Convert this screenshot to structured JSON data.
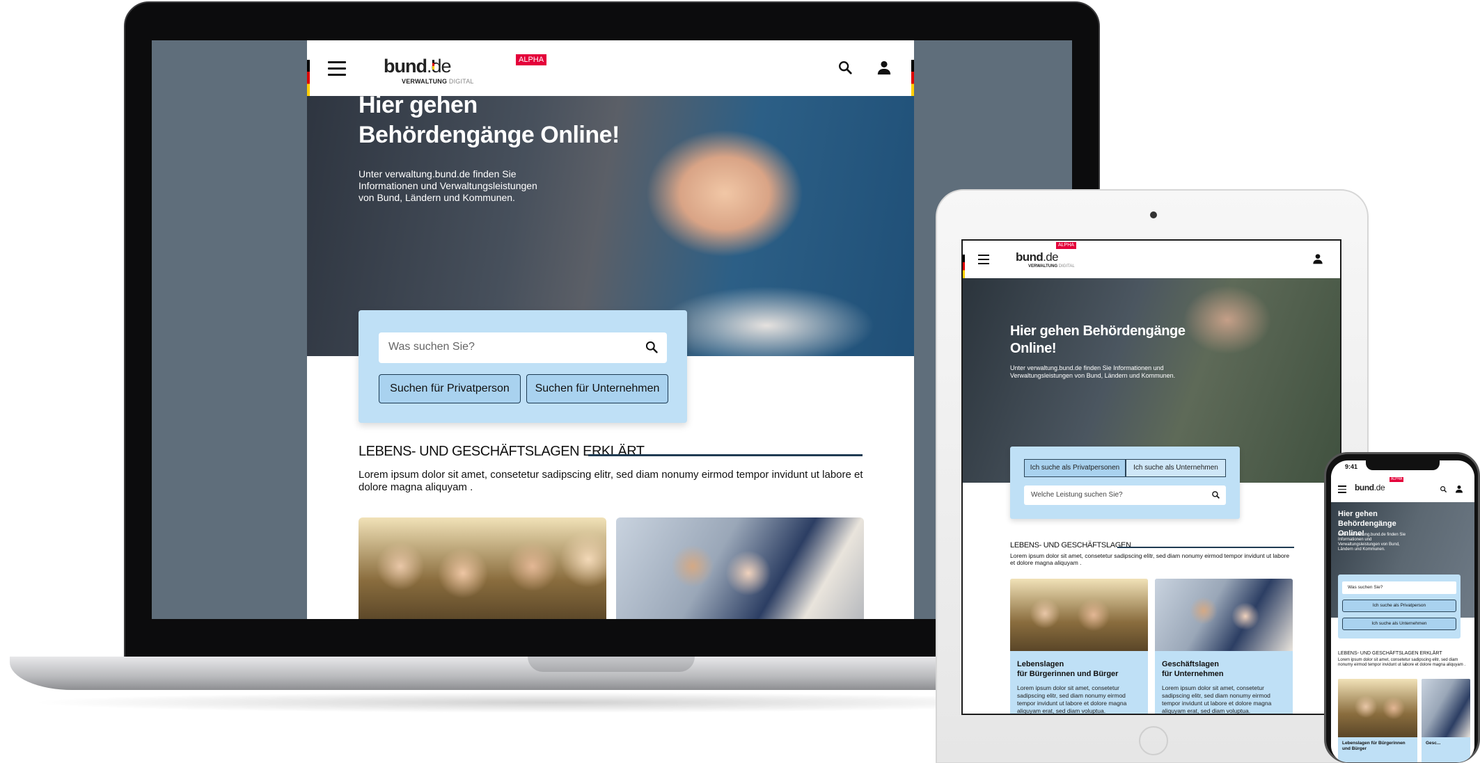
{
  "brand": {
    "word": "bund",
    "tld": ".de",
    "sub_main": "VERWALTUNG",
    "sub_light": "DIGITAL",
    "badge": "ALPHA"
  },
  "desktop": {
    "hero_title": "Hier gehen Behördengänge Online!",
    "hero_text": "Unter verwaltung.bund.de finden Sie Informationen und Verwaltungsleistungen von Bund, Ländern und Kommunen.",
    "search_placeholder": "Was suchen Sie?",
    "btn_private": "Suchen für Privatperson",
    "btn_business": "Suchen für Unternehmen",
    "section_title": "LEBENS- UND GESCHÄFTSLAGEN ERKLÄRT",
    "section_text": "Lorem ipsum dolor sit amet, consetetur sadipscing elitr, sed diam nonumy eirmod tempor invidunt ut labore et dolore magna aliquyam ."
  },
  "tablet": {
    "hero_title": "Hier gehen Behördengänge Online!",
    "hero_text": "Unter verwaltung.bund.de finden Sie Informationen und Verwaltungsleistungen von Bund, Ländern und Kommunen.",
    "tab_private": "Ich suche als Privatpersonen",
    "tab_business": "Ich suche als Unternehmen",
    "search_placeholder": "Welche Leistung suchen Sie?",
    "section_title": "LEBENS- UND GESCHÄFTSLAGEN",
    "section_text": "Lorem ipsum dolor sit amet, consetetur sadipscing elitr, sed diam nonumy eirmod tempor invidunt ut labore et dolore magna aliquyam .",
    "cards": [
      {
        "title1": "Lebenslagen",
        "title2": "für Bürgerinnen und Bürger",
        "text": "Lorem ipsum dolor sit amet, consetetur sadipscing elitr, sed diam nonumy eirmod tempor invidunt ut labore et dolore magna aliquyam erat, sed diam voluptua."
      },
      {
        "title1": "Geschäftslagen",
        "title2": "für Unternehmen",
        "text": "Lorem ipsum dolor sit amet, consetetur sadipscing elitr, sed diam nonumy eirmod tempor invidunt ut labore et dolore magna aliquyam erat, sed diam voluptua."
      }
    ]
  },
  "phone": {
    "time": "9:41",
    "hero_title": "Hier gehen Behördengänge Online!",
    "hero_text": "Unter verwaltung.bund.de finden Sie Informationen und Verwaltungsleistungen von Bund, Ländern und Kommunen.",
    "search_placeholder": "Was suchen Sie?",
    "btn_private": "Ich suche als Privatperson",
    "btn_business": "Ich suche als Unternehmen",
    "section_title": "LEBENS- UND GESCHÄFTSLAGEN ERKLÄRT",
    "section_text": "Lorem ipsum dolor sit amet, consetetur sadipscing elitr, sed diam nonumy eirmod tempor invidunt ut labore et dolore magna aliquyam .",
    "card1_title": "Lebenslagen für Bürgerinnen und Bürger",
    "card2_title": "Gesc..."
  },
  "icons": {
    "menu": "hamburger-menu-icon",
    "search": "search-icon",
    "account": "user-account-icon"
  }
}
